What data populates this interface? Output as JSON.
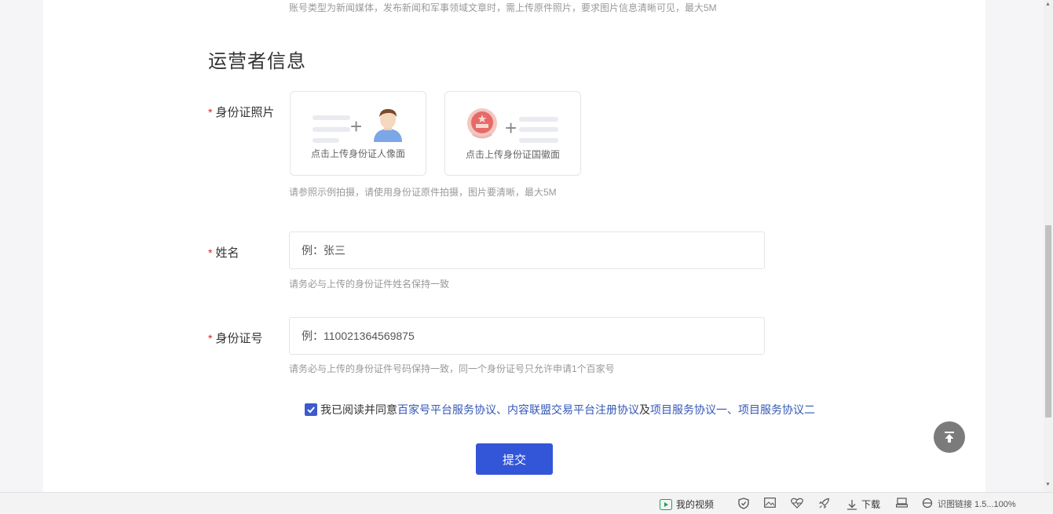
{
  "top_hint": "账号类型为新闻媒体，发布新闻和军事领域文章时，需上传原件照片，要求图片信息清晰可见，最大5M",
  "section_title": "运营者信息",
  "required_mark": "*",
  "id_photo": {
    "label": "身份证照片",
    "front_caption": "点击上传身份证人像面",
    "back_caption": "点击上传身份证国徽面",
    "hint": "请参照示例拍摄，请使用身份证原件拍摄，图片要清晰，最大5M"
  },
  "name": {
    "label": "姓名",
    "placeholder": "例：张三",
    "hint": "请务必与上传的身份证件姓名保持一致"
  },
  "id_number": {
    "label": "身份证号",
    "placeholder": "例：110021364569875",
    "hint": "请务必与上传的身份证件号码保持一致，同一个身份证号只允许申请1个百家号"
  },
  "agreement": {
    "checked": true,
    "prefix": "我已阅读并同意",
    "link1": "百家号平台服务协议",
    "sep1": "、",
    "link2": "内容联盟交易平台注册协议",
    "sep2": "及",
    "link3": "项目服务协议一",
    "sep3": "、",
    "link4": "项目服务协议二"
  },
  "submit_label": "提交",
  "statusbar": {
    "my_video": "我的视频",
    "download": "下载",
    "tail_text": "识图链接 1.5...100%"
  },
  "colors": {
    "accent": "#3355d8",
    "link": "#3557b7",
    "required": "#e02020"
  }
}
